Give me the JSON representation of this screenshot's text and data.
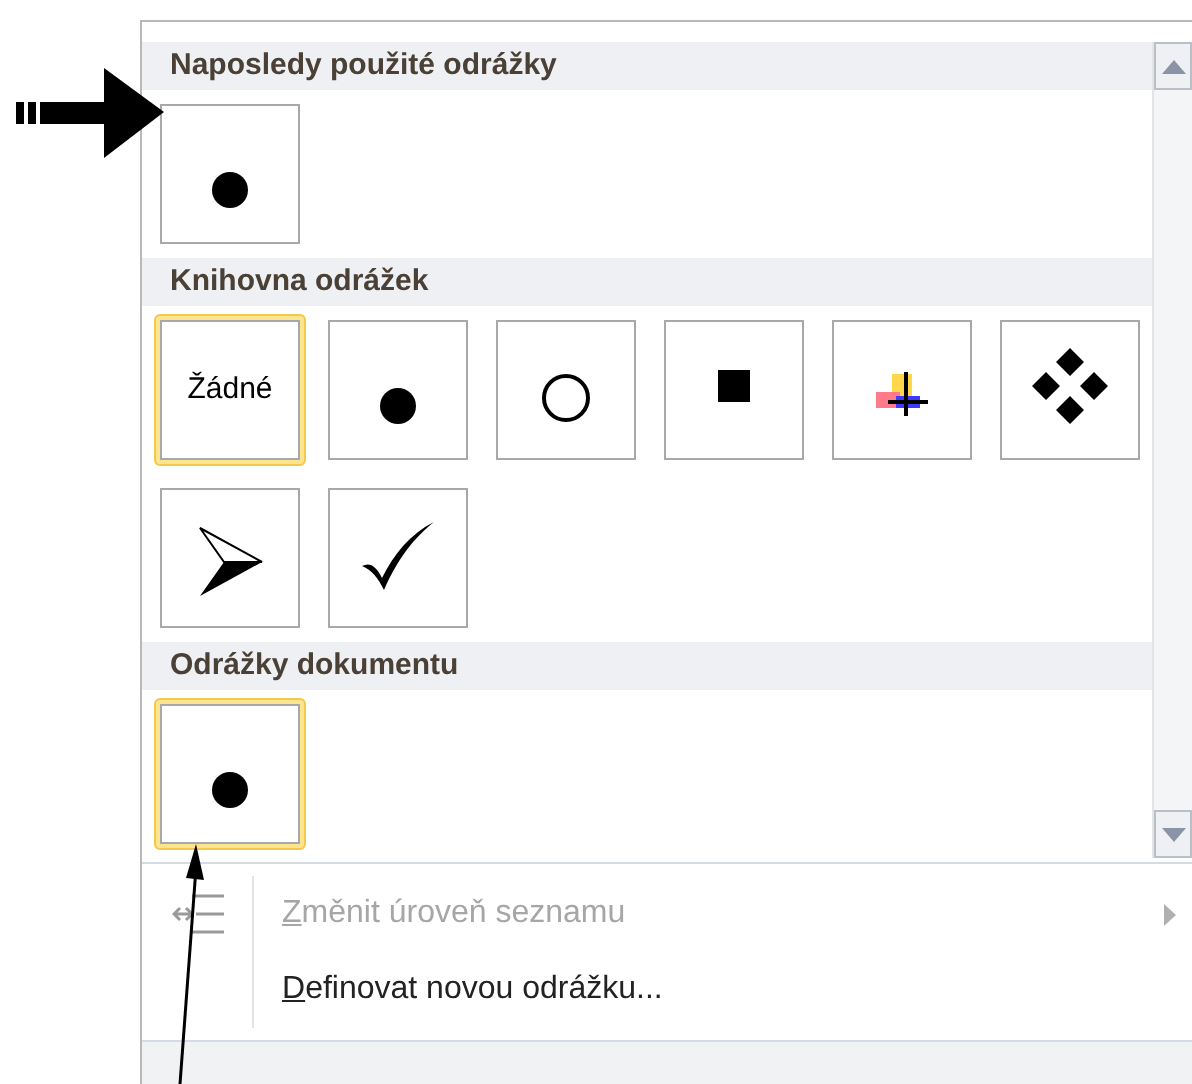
{
  "sections": [
    {
      "title": "Naposledy použité odrážky",
      "bullets": [
        {
          "kind": "dot",
          "selected": false
        }
      ]
    },
    {
      "title": "Knihovna odrážek",
      "bullets": [
        {
          "kind": "text",
          "label": "Žádné",
          "selected": true
        },
        {
          "kind": "dot",
          "selected": false
        },
        {
          "kind": "circle",
          "selected": false
        },
        {
          "kind": "square",
          "selected": false
        },
        {
          "kind": "picture",
          "selected": false
        },
        {
          "kind": "diamonds",
          "selected": false
        },
        {
          "kind": "arrowhead",
          "selected": false
        },
        {
          "kind": "check",
          "selected": false
        }
      ]
    },
    {
      "title": "Odrážky dokumentu",
      "bullets": [
        {
          "kind": "dot",
          "selected": true
        }
      ]
    }
  ],
  "menu_items": [
    {
      "label": "Změnit úroveň seznamu",
      "disabled": true,
      "submenu": true,
      "icon": true
    },
    {
      "label": "Definovat novou odrážku...",
      "disabled": false,
      "submenu": false,
      "icon": false
    }
  ]
}
